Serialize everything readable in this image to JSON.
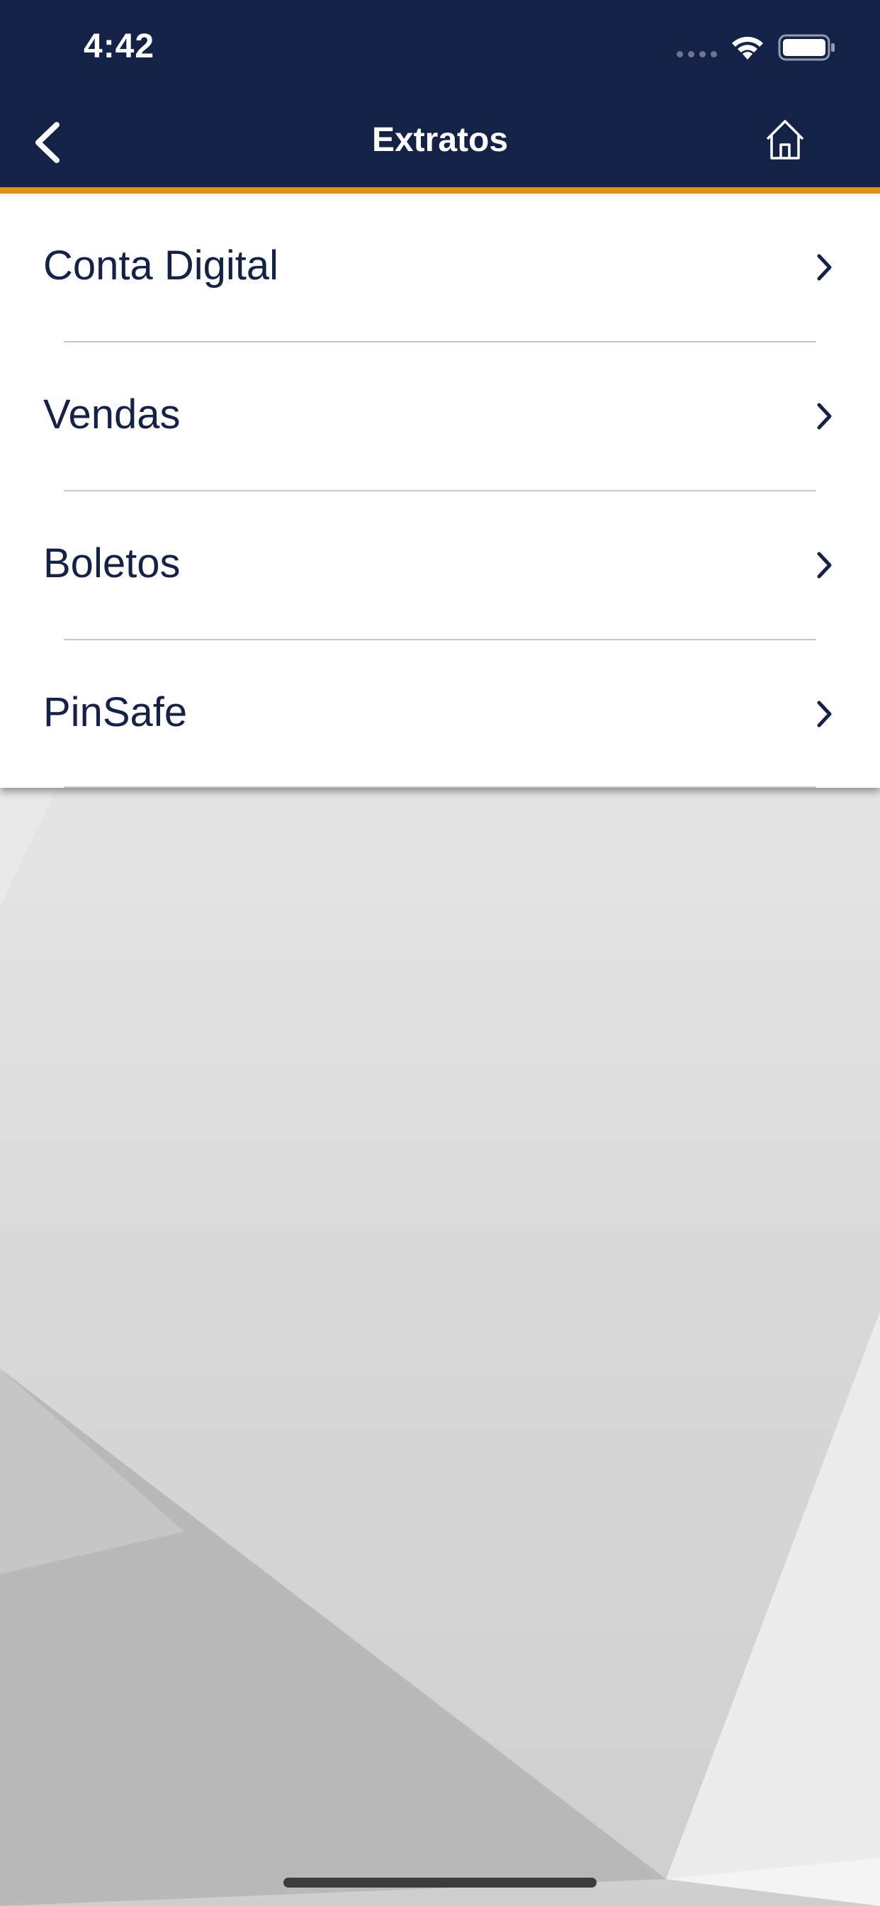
{
  "status_bar": {
    "time": "4:42"
  },
  "nav": {
    "title": "Extratos",
    "back_icon": "chevron-left-icon",
    "home_icon": "home-icon"
  },
  "menu": {
    "items": [
      {
        "label": "Conta Digital"
      },
      {
        "label": "Vendas"
      },
      {
        "label": "Boletos"
      },
      {
        "label": "PinSafe"
      }
    ]
  },
  "colors": {
    "header_bg": "#132246",
    "accent": "#e39418",
    "text": "#132246"
  }
}
